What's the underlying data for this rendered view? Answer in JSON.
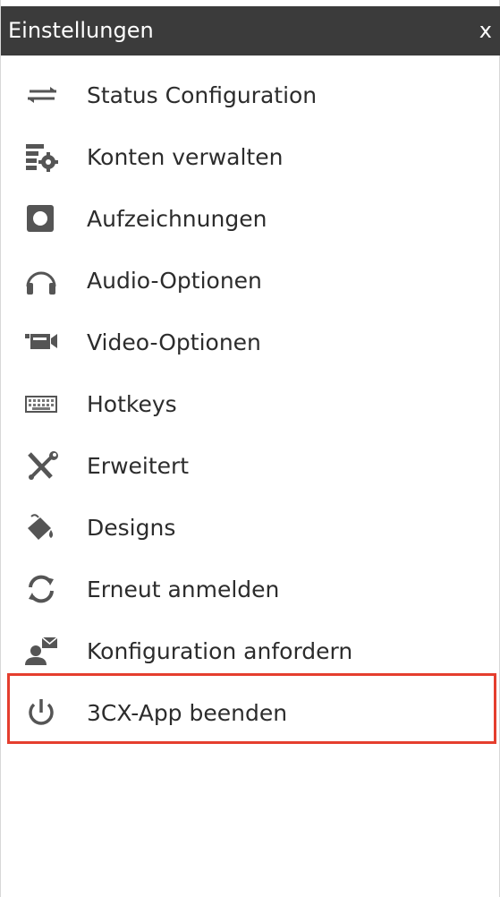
{
  "header": {
    "title": "Einstellungen",
    "close_label": "x"
  },
  "menu": {
    "items": [
      {
        "label": "Status Configuration",
        "icon": "arrows-swap-icon"
      },
      {
        "label": "Konten verwalten",
        "icon": "accounts-gear-icon"
      },
      {
        "label": "Aufzeichnungen",
        "icon": "record-icon"
      },
      {
        "label": "Audio-Optionen",
        "icon": "headphones-icon"
      },
      {
        "label": "Video-Optionen",
        "icon": "video-camera-icon"
      },
      {
        "label": "Hotkeys",
        "icon": "keyboard-icon"
      },
      {
        "label": "Erweitert",
        "icon": "wrench-screwdriver-icon"
      },
      {
        "label": "Designs",
        "icon": "paint-bucket-icon"
      },
      {
        "label": "Erneut anmelden",
        "icon": "refresh-icon"
      },
      {
        "label": "Konfiguration anfordern",
        "icon": "user-mail-icon"
      },
      {
        "label": "3CX-App beenden",
        "icon": "power-icon"
      }
    ]
  },
  "colors": {
    "header_bg": "#3b3b3b",
    "icon": "#555555",
    "highlight": "#e53e2e"
  }
}
